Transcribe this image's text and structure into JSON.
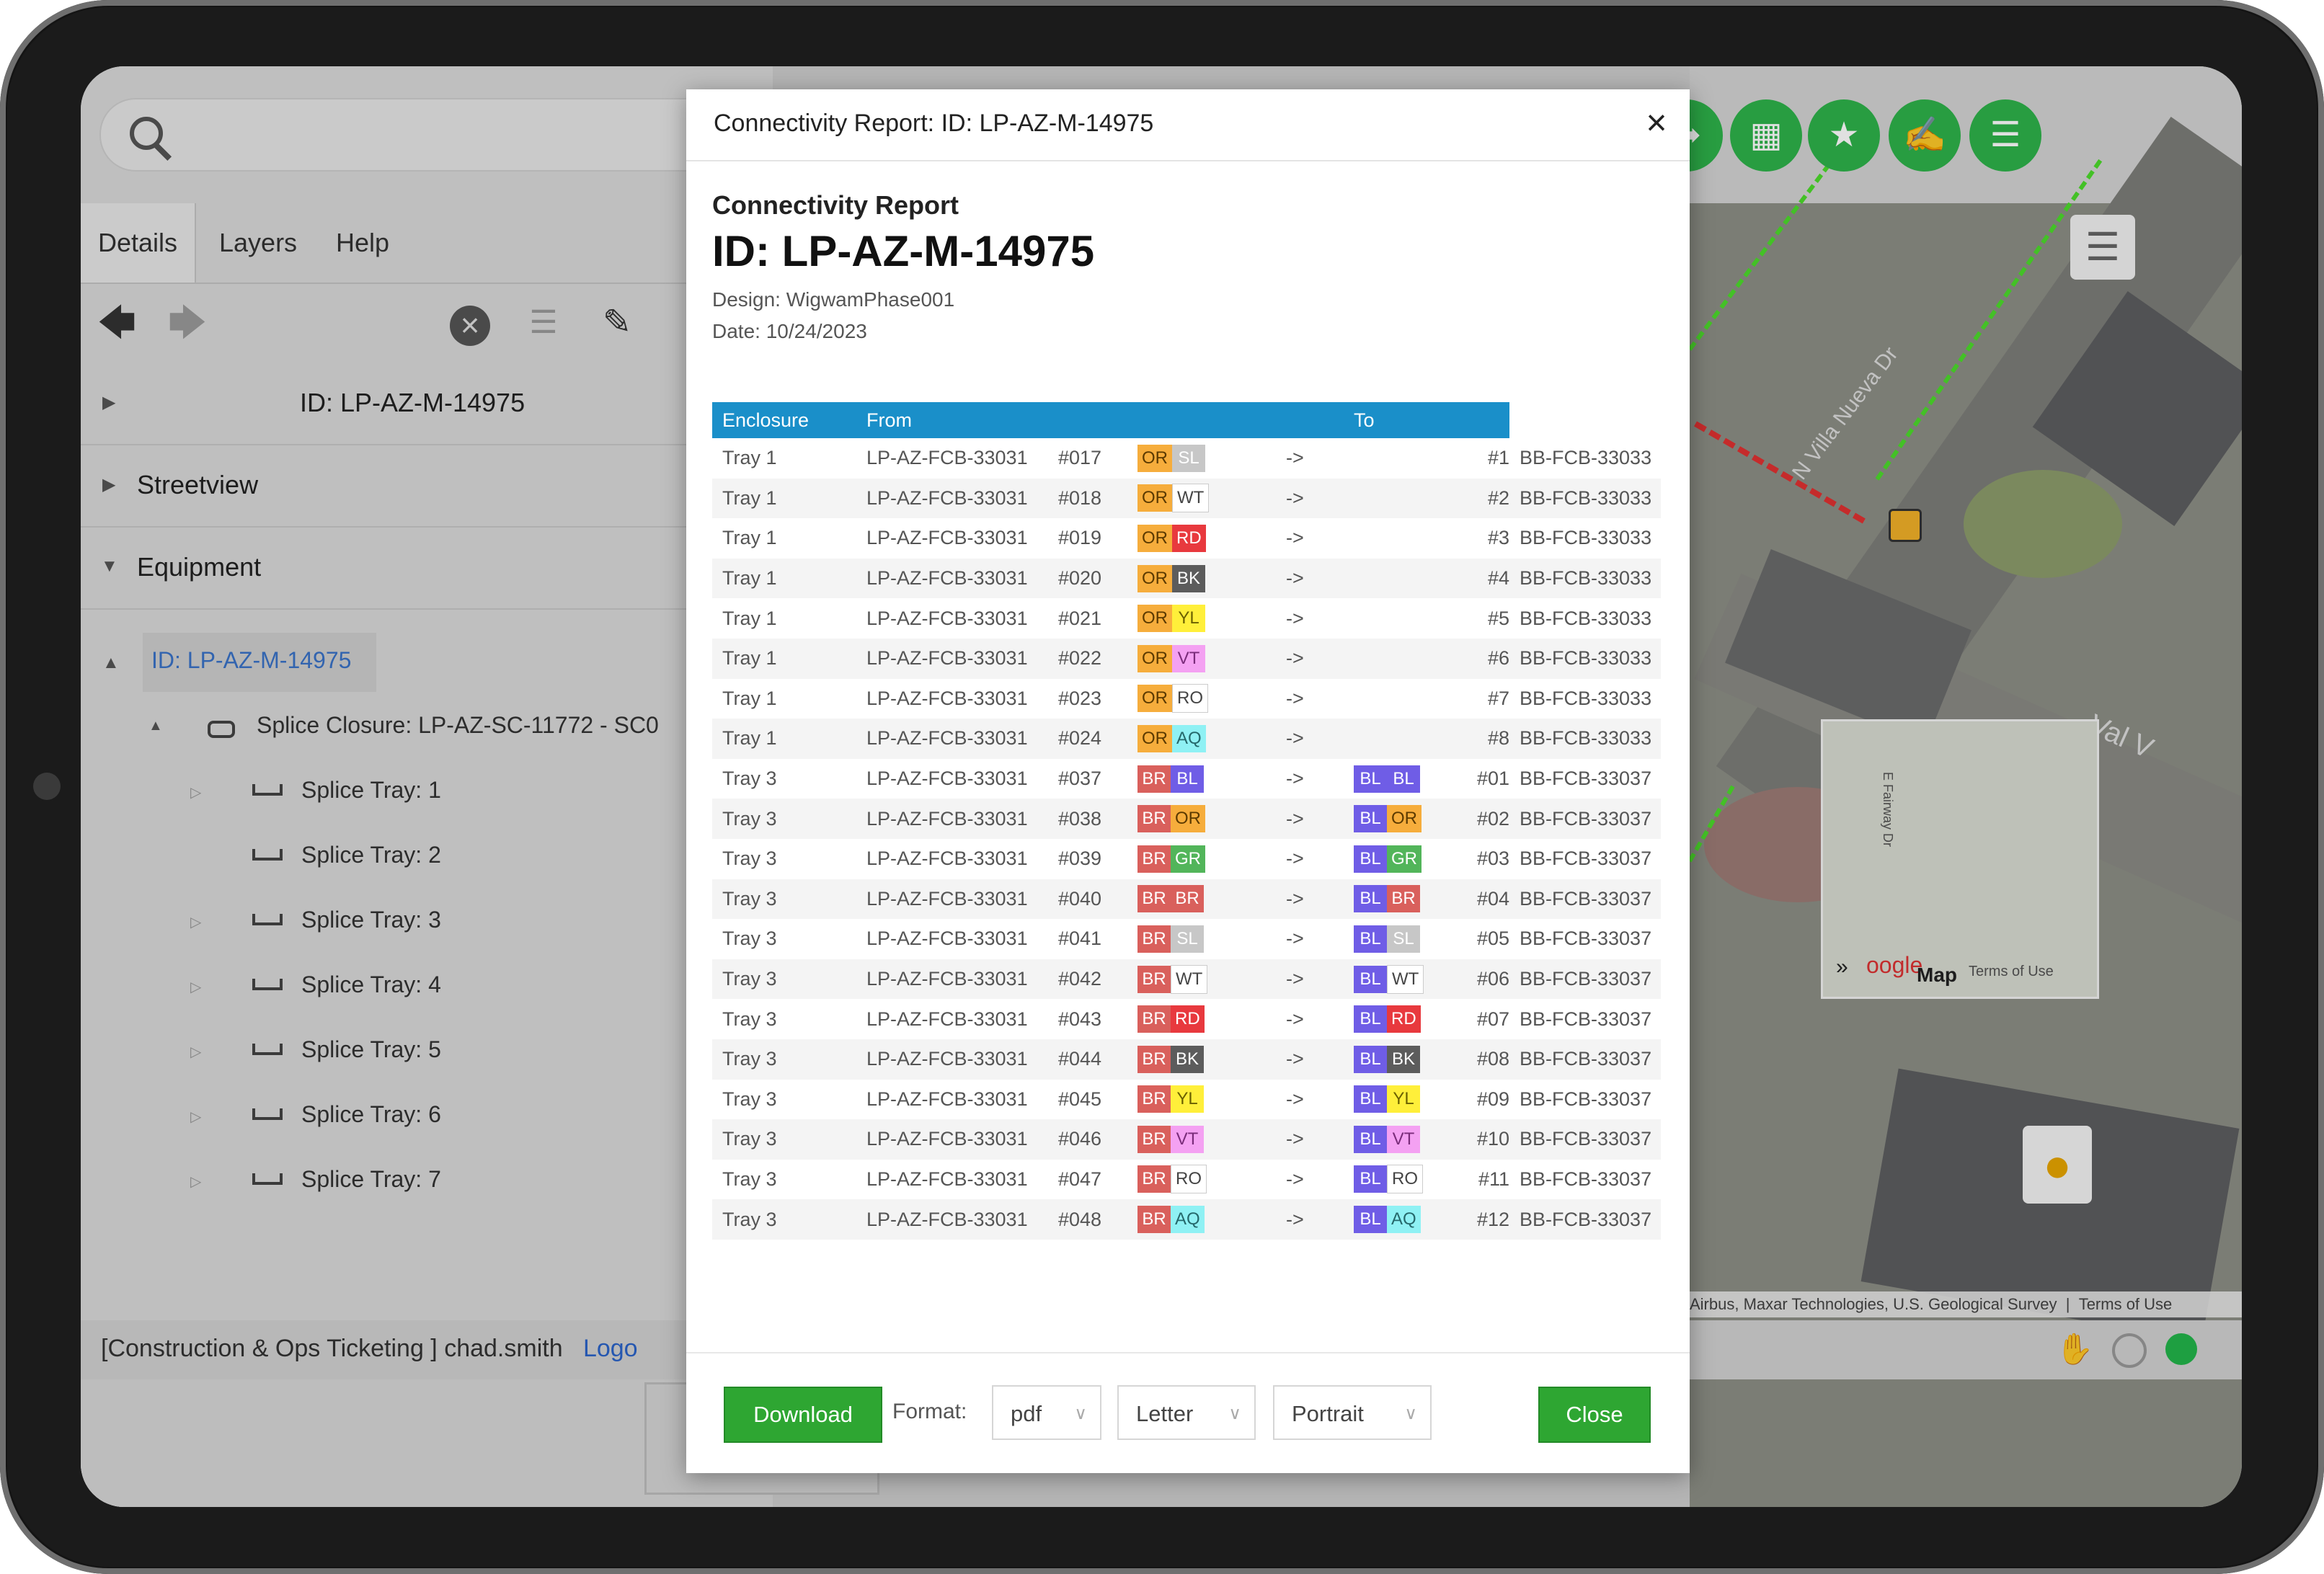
{
  "left_panel": {
    "tabs": [
      "Details",
      "Layers",
      "Help"
    ],
    "header_id": "ID: LP-AZ-M-14975",
    "sections": {
      "streetview": "Streetview",
      "equipment": "Equipment"
    },
    "tree": {
      "root": "ID: LP-AZ-M-14975",
      "closure": "Splice Closure: LP-AZ-SC-11772 - SC0",
      "trays": [
        "Splice Tray: 1",
        "Splice Tray: 2",
        "Splice Tray: 3",
        "Splice Tray: 4",
        "Splice Tray: 5",
        "Splice Tray: 6",
        "Splice Tray: 7"
      ]
    },
    "status": "[Construction & Ops Ticketing ] chad.smith",
    "logout": "Logo"
  },
  "map": {
    "street_label": "N Villa Nueva Dr",
    "street_label_2": "Val V",
    "minimap_road": "E Fairway Dr",
    "minimap_logo": "oogle",
    "minimap_map": "Map",
    "minimap_terms": "Terms of Use",
    "attribution": "Airbus, Maxar Technologies, U.S. Geological Survey",
    "terms": "Terms of Use",
    "icons": [
      "share-icon",
      "network-icon",
      "connect-icon",
      "edit-document-icon",
      "report-icon"
    ]
  },
  "modal": {
    "title": "Connectivity Report: ID: LP-AZ-M-14975",
    "subtitle": "Connectivity Report",
    "id": "ID: LP-AZ-M-14975",
    "design": "Design: WigwamPhase001",
    "date": "Date: 10/24/2023",
    "columns": [
      "Enclosure",
      "From",
      "To"
    ],
    "rows": [
      {
        "enc": "Tray 1",
        "from": "LP-AZ-FCB-33031",
        "fnum": "#017",
        "fa": "OR",
        "fb": "SL",
        "arrow": "->",
        "ta": "",
        "tb": "",
        "tnum": "#1",
        "to": "BB-FCB-33033"
      },
      {
        "enc": "Tray 1",
        "from": "LP-AZ-FCB-33031",
        "fnum": "#018",
        "fa": "OR",
        "fb": "WT",
        "arrow": "->",
        "ta": "",
        "tb": "",
        "tnum": "#2",
        "to": "BB-FCB-33033"
      },
      {
        "enc": "Tray 1",
        "from": "LP-AZ-FCB-33031",
        "fnum": "#019",
        "fa": "OR",
        "fb": "RD",
        "arrow": "->",
        "ta": "",
        "tb": "",
        "tnum": "#3",
        "to": "BB-FCB-33033"
      },
      {
        "enc": "Tray 1",
        "from": "LP-AZ-FCB-33031",
        "fnum": "#020",
        "fa": "OR",
        "fb": "BK",
        "arrow": "->",
        "ta": "",
        "tb": "",
        "tnum": "#4",
        "to": "BB-FCB-33033"
      },
      {
        "enc": "Tray 1",
        "from": "LP-AZ-FCB-33031",
        "fnum": "#021",
        "fa": "OR",
        "fb": "YL",
        "arrow": "->",
        "ta": "",
        "tb": "",
        "tnum": "#5",
        "to": "BB-FCB-33033"
      },
      {
        "enc": "Tray 1",
        "from": "LP-AZ-FCB-33031",
        "fnum": "#022",
        "fa": "OR",
        "fb": "VT",
        "arrow": "->",
        "ta": "",
        "tb": "",
        "tnum": "#6",
        "to": "BB-FCB-33033"
      },
      {
        "enc": "Tray 1",
        "from": "LP-AZ-FCB-33031",
        "fnum": "#023",
        "fa": "OR",
        "fb": "RO",
        "arrow": "->",
        "ta": "",
        "tb": "",
        "tnum": "#7",
        "to": "BB-FCB-33033"
      },
      {
        "enc": "Tray 1",
        "from": "LP-AZ-FCB-33031",
        "fnum": "#024",
        "fa": "OR",
        "fb": "AQ",
        "arrow": "->",
        "ta": "",
        "tb": "",
        "tnum": "#8",
        "to": "BB-FCB-33033"
      },
      {
        "enc": "Tray 3",
        "from": "LP-AZ-FCB-33031",
        "fnum": "#037",
        "fa": "BR",
        "fb": "BL",
        "arrow": "->",
        "ta": "BL",
        "tb": "BL",
        "tnum": "#01",
        "to": "BB-FCB-33037"
      },
      {
        "enc": "Tray 3",
        "from": "LP-AZ-FCB-33031",
        "fnum": "#038",
        "fa": "BR",
        "fb": "OR",
        "arrow": "->",
        "ta": "BL",
        "tb": "OR",
        "tnum": "#02",
        "to": "BB-FCB-33037"
      },
      {
        "enc": "Tray 3",
        "from": "LP-AZ-FCB-33031",
        "fnum": "#039",
        "fa": "BR",
        "fb": "GR",
        "arrow": "->",
        "ta": "BL",
        "tb": "GR",
        "tnum": "#03",
        "to": "BB-FCB-33037"
      },
      {
        "enc": "Tray 3",
        "from": "LP-AZ-FCB-33031",
        "fnum": "#040",
        "fa": "BR",
        "fb": "BR",
        "arrow": "->",
        "ta": "BL",
        "tb": "BR",
        "tnum": "#04",
        "to": "BB-FCB-33037"
      },
      {
        "enc": "Tray 3",
        "from": "LP-AZ-FCB-33031",
        "fnum": "#041",
        "fa": "BR",
        "fb": "SL",
        "arrow": "->",
        "ta": "BL",
        "tb": "SL",
        "tnum": "#05",
        "to": "BB-FCB-33037"
      },
      {
        "enc": "Tray 3",
        "from": "LP-AZ-FCB-33031",
        "fnum": "#042",
        "fa": "BR",
        "fb": "WT",
        "arrow": "->",
        "ta": "BL",
        "tb": "WT",
        "tnum": "#06",
        "to": "BB-FCB-33037"
      },
      {
        "enc": "Tray 3",
        "from": "LP-AZ-FCB-33031",
        "fnum": "#043",
        "fa": "BR",
        "fb": "RD",
        "arrow": "->",
        "ta": "BL",
        "tb": "RD",
        "tnum": "#07",
        "to": "BB-FCB-33037"
      },
      {
        "enc": "Tray 3",
        "from": "LP-AZ-FCB-33031",
        "fnum": "#044",
        "fa": "BR",
        "fb": "BK",
        "arrow": "->",
        "ta": "BL",
        "tb": "BK",
        "tnum": "#08",
        "to": "BB-FCB-33037"
      },
      {
        "enc": "Tray 3",
        "from": "LP-AZ-FCB-33031",
        "fnum": "#045",
        "fa": "BR",
        "fb": "YL",
        "arrow": "->",
        "ta": "BL",
        "tb": "YL",
        "tnum": "#09",
        "to": "BB-FCB-33037"
      },
      {
        "enc": "Tray 3",
        "from": "LP-AZ-FCB-33031",
        "fnum": "#046",
        "fa": "BR",
        "fb": "VT",
        "arrow": "->",
        "ta": "BL",
        "tb": "VT",
        "tnum": "#10",
        "to": "BB-FCB-33037"
      },
      {
        "enc": "Tray 3",
        "from": "LP-AZ-FCB-33031",
        "fnum": "#047",
        "fa": "BR",
        "fb": "RO",
        "arrow": "->",
        "ta": "BL",
        "tb": "RO",
        "tnum": "#11",
        "to": "BB-FCB-33037"
      },
      {
        "enc": "Tray 3",
        "from": "LP-AZ-FCB-33031",
        "fnum": "#048",
        "fa": "BR",
        "fb": "AQ",
        "arrow": "->",
        "ta": "BL",
        "tb": "AQ",
        "tnum": "#12",
        "to": "BB-FCB-33037"
      }
    ],
    "footer": {
      "download": "Download",
      "format_label": "Format:",
      "format": "pdf",
      "paper": "Letter",
      "orientation": "Portrait",
      "close": "Close"
    }
  },
  "fiber_colors": {
    "OR": {
      "bg": "#f6ad3c",
      "fg": "#5b3a00"
    },
    "BR": {
      "bg": "#d9605c",
      "fg": "#ffffff"
    },
    "BL": {
      "bg": "#6f5de6",
      "fg": "#ffffff"
    },
    "SL": {
      "bg": "#c7c7c7",
      "fg": "#ffffff"
    },
    "WT": {
      "bg": "#ffffff",
      "fg": "#444444"
    },
    "RD": {
      "bg": "#e8393e",
      "fg": "#ffffff"
    },
    "BK": {
      "bg": "#5c5c5c",
      "fg": "#ffffff"
    },
    "YL": {
      "bg": "#ffef3a",
      "fg": "#6a6000"
    },
    "VT": {
      "bg": "#f4a1f2",
      "fg": "#7a2c7a"
    },
    "RO": {
      "bg": "#ffffff",
      "fg": "#444444"
    },
    "AQ": {
      "bg": "#8ff1f4",
      "fg": "#25686b"
    },
    "GR": {
      "bg": "#52b55a",
      "fg": "#ffffff"
    }
  }
}
